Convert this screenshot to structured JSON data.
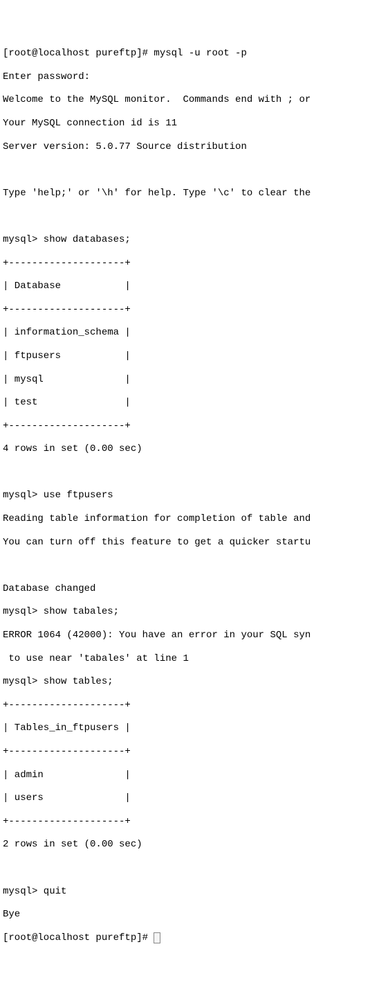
{
  "lines": {
    "l0": "[root@localhost pureftp]# mysql -u root -p",
    "l1": "Enter password:",
    "l2": "Welcome to the MySQL monitor.  Commands end with ; or",
    "l3": "Your MySQL connection id is 11",
    "l4": "Server version: 5.0.77 Source distribution",
    "l5": "",
    "l6": "Type 'help;' or '\\h' for help. Type '\\c' to clear the",
    "l7": "",
    "l8": "mysql> show databases;",
    "l9": "+--------------------+",
    "l10": "| Database           |",
    "l11": "+--------------------+",
    "l12": "| information_schema |",
    "l13": "| ftpusers           |",
    "l14": "| mysql              |",
    "l15": "| test               |",
    "l16": "+--------------------+",
    "l17": "4 rows in set (0.00 sec)",
    "l18": "",
    "l19": "mysql> use ftpusers",
    "l20": "Reading table information for completion of table and",
    "l21": "You can turn off this feature to get a quicker startu",
    "l22": "",
    "l23": "Database changed",
    "l24": "mysql> show tabales;",
    "l25": "ERROR 1064 (42000): You have an error in your SQL syn",
    "l26": " to use near 'tabales' at line 1",
    "l27": "mysql> show tables;",
    "l28": "+--------------------+",
    "l29": "| Tables_in_ftpusers |",
    "l30": "+--------------------+",
    "l31": "| admin              |",
    "l32": "| users              |",
    "l33": "+--------------------+",
    "l34": "2 rows in set (0.00 sec)",
    "l35": "",
    "l36": "mysql> quit",
    "l37": "Bye",
    "l38": "[root@localhost pureftp]# "
  }
}
